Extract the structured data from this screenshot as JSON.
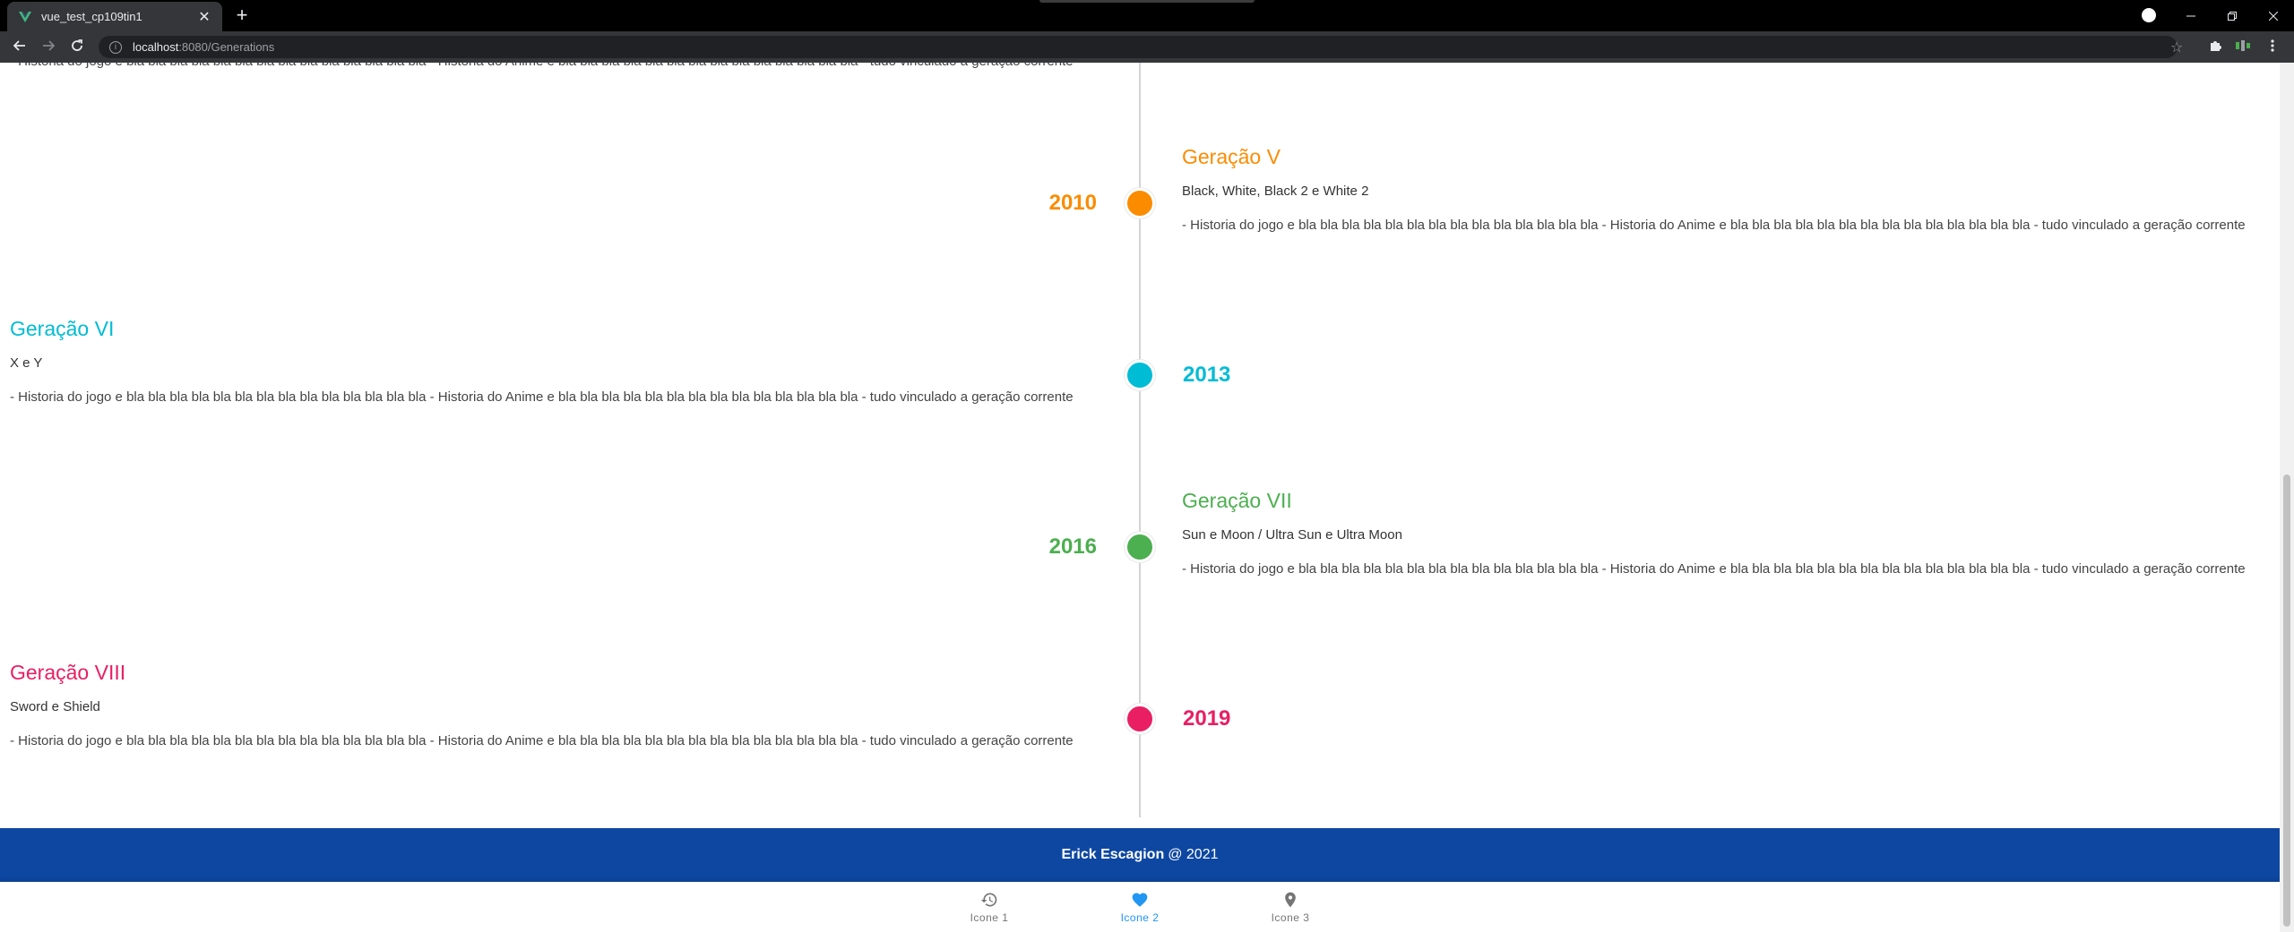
{
  "browser": {
    "tab_title": "vue_test_cp109tin1",
    "new_tab": "+",
    "tab_close": "✕",
    "url_host": "localhost",
    "url_path": ":8080/Generations"
  },
  "top_card": {
    "body": "- Historia do jogo e bla bla bla bla bla bla bla bla bla bla bla bla bla bla - Historia do Anime e bla bla bla bla bla bla bla bla bla bla bla bla bla bla - tudo vinculado a geração corrente"
  },
  "generations": [
    {
      "title": "Geração V",
      "year": "2010",
      "games": "Black, White, Black 2 e White 2",
      "body": "- Historia do jogo e bla bla bla bla bla bla bla bla bla bla bla bla bla bla - Historia do Anime e bla bla bla bla bla bla bla bla bla bla bla bla bla bla - tudo vinculado a geração corrente",
      "color": "#fb8c00"
    },
    {
      "title": "Geração VI",
      "year": "2013",
      "games": "X e Y",
      "body": "- Historia do jogo e bla bla bla bla bla bla bla bla bla bla bla bla bla bla - Historia do Anime e bla bla bla bla bla bla bla bla bla bla bla bla bla bla - tudo vinculado a geração corrente",
      "color": "#00bcd4"
    },
    {
      "title": "Geração VII",
      "year": "2016",
      "games": "Sun e Moon / Ultra Sun e Ultra Moon",
      "body": "- Historia do jogo e bla bla bla bla bla bla bla bla bla bla bla bla bla bla - Historia do Anime e bla bla bla bla bla bla bla bla bla bla bla bla bla bla - tudo vinculado a geração corrente",
      "color": "#4caf50"
    },
    {
      "title": "Geração VIII",
      "year": "2019",
      "games": "Sword e Shield",
      "body": "- Historia do jogo e bla bla bla bla bla bla bla bla bla bla bla bla bla bla - Historia do Anime e bla bla bla bla bla bla bla bla bla bla bla bla bla bla - tudo vinculado a geração corrente",
      "color": "#e91e63"
    }
  ],
  "footer": {
    "author": "Erick Escagion",
    "suffix": "@ 2021"
  },
  "bottom_nav": {
    "items": [
      {
        "label": "Icone 1",
        "icon": "history-icon"
      },
      {
        "label": "Icone 2",
        "icon": "heart-icon"
      },
      {
        "label": "Icone 3",
        "icon": "map-marker-icon"
      }
    ],
    "active_color": "#2196f3"
  }
}
